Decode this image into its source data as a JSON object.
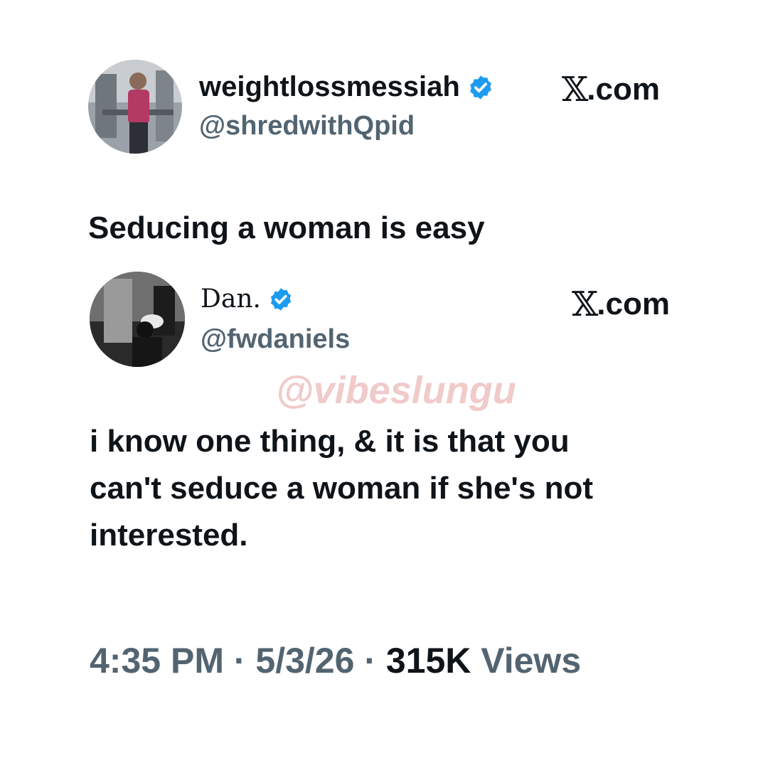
{
  "tweet1": {
    "display_name": "weightlossmessiah",
    "handle": "@shredwithQpid",
    "verified_icon": "verified-badge-icon",
    "site_logo": "𝕏",
    "site_text": ".com",
    "text": "Seducing a woman is easy"
  },
  "tweet2": {
    "display_name": "Dan.",
    "handle": "@fwdaniels",
    "verified_icon": "verified-badge-icon",
    "site_logo": "𝕏",
    "site_text": ".com",
    "text_lines": [
      "i know one thing, & it is that you",
      "can't seduce a woman if she's not",
      "interested."
    ]
  },
  "watermark": "@vibeslungu",
  "meta": {
    "time": "4:35 PM",
    "separator": " · ",
    "date": "5/3/26",
    "views_count": "315K",
    "views_label": " Views"
  },
  "colors": {
    "text": "#0f1419",
    "secondary": "#536471",
    "verified": "#1d9bf0",
    "watermark": "#f1caca"
  }
}
